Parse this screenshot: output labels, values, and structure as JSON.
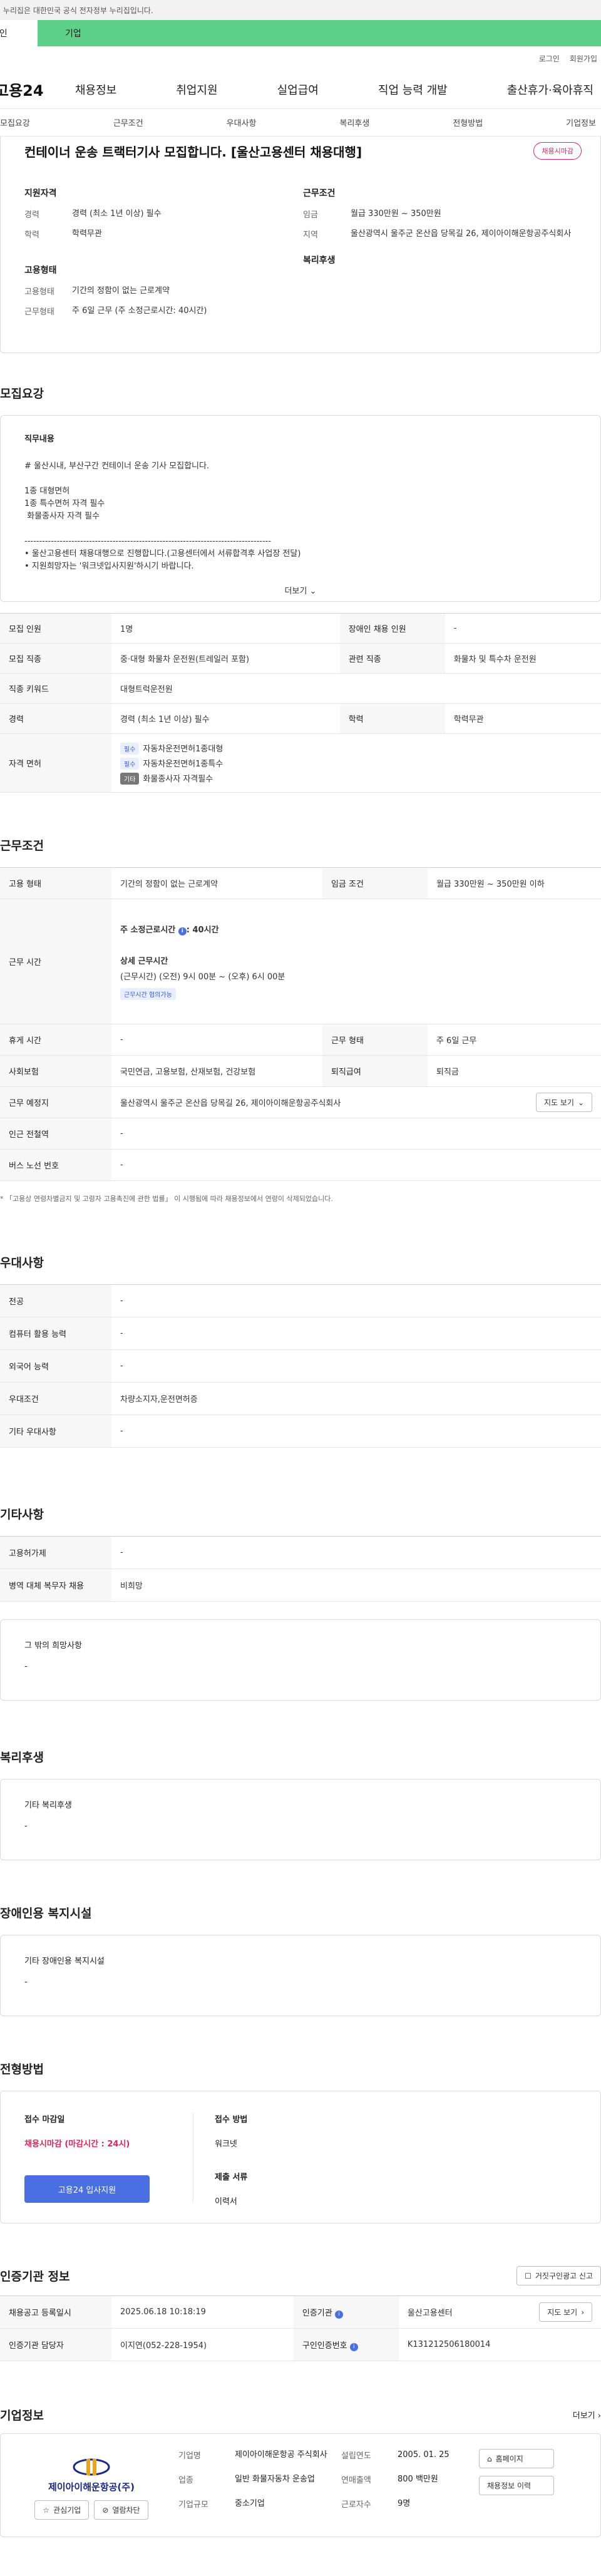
{
  "gov_notice": "이 누리집은 대한민국 공식 전자정부 누리집입니다.",
  "tabs": {
    "individual": "개인",
    "company": "기업"
  },
  "util": {
    "login": "로그인",
    "join": "회원가입"
  },
  "logo": "고용24",
  "gnb": [
    "채용정보",
    "취업지원",
    "실업급여",
    "직업 능력 개발",
    "출산휴가·육아휴직"
  ],
  "subnav": [
    "모집요강",
    "근무조건",
    "우대사항",
    "복리후생",
    "전형방법",
    "기업정보"
  ],
  "job": {
    "title": "컨테이너 운송 트랙터기사 모집합니다. [울산고용센터 채용대행]",
    "status_badge": "채용시마감",
    "qual_heading": "지원자격",
    "cond_heading": "근무조건",
    "type_heading": "고용형태",
    "welfare_heading": "복리후생",
    "career_label": "경력",
    "career_value": "경력 (최소 1년 이상) 필수",
    "edu_label": "학력",
    "edu_value": "학력무관",
    "wage_label": "임금",
    "wage_value": "월급 330만원 ~ 350만원",
    "region_label": "지역",
    "region_value": "울산광역시 울주군 온산읍 당목길 26, 제이아이해운항공주식회사",
    "emptype_label": "고용형태",
    "emptype_value": "기간의 정함이 없는 근로계약",
    "worktype_label": "근무형태",
    "worktype_value": "주 6일 근무 (주 소정근로시간: 40시간)"
  },
  "recruit": {
    "title": "모집요강",
    "duty_heading": "직무내용",
    "lines": [
      "# 울산시내, 부산구간 컨테이너 운송 기사 모집합니다.",
      "",
      "1종 대형면허",
      "1종 특수면허 자격 필수",
      " 화물종사자 자격 필수",
      "",
      "------------------------------------------------------------------------------------",
      "• 울산고용센터 채용대행으로 진행합니다.(고용센터에서 서류합격후 사업장 전달)",
      "• 지원희망자는 '워크넷입사지원'하시기 바랍니다."
    ],
    "more": "더보기",
    "table": {
      "headcount_k": "모집 인원",
      "headcount_v": "1명",
      "disabled_k": "장애인 채용 인원",
      "disabled_v": "-",
      "job_k": "모집 직종",
      "job_v": "중·대형 화물차 운전원(트레일러 포함)",
      "related_k": "관련 직종",
      "related_v": "화물차 및 특수차 운전원",
      "keyword_k": "직종 키워드",
      "keyword_v": "대형트럭운전원",
      "career_k": "경력",
      "career_v": "경력 (최소 1년 이상) 필수",
      "edu_k": "학력",
      "edu_v": "학력무관",
      "license_k": "자격 면허",
      "licenses": [
        {
          "tag": "필수",
          "name": "자동차운전면허1종대형"
        },
        {
          "tag": "필수",
          "name": "자동차운전면허1종특수"
        },
        {
          "tag": "기타",
          "name": "화물종사자 자격필수"
        }
      ]
    }
  },
  "conditions": {
    "title": "근무조건",
    "emptype_k": "고용 형태",
    "emptype_v": "기간의 정함이 없는 근로계약",
    "wage_k": "임금 조건",
    "wage_v": "월급 330만원 ~ 350만원 이하",
    "hours_k": "근무 시간",
    "hours_total_label": "주 소정근로시간",
    "hours_total_value": ": 40시간",
    "hours_detail_label": "상세 근무시간",
    "hours_detail_value": "(근무시간) (오전) 9시 00분 ~ (오후) 6시 00분",
    "hours_flex": "근무시간 협의가능",
    "rest_k": "휴게 시간",
    "rest_v": "-",
    "workform_k": "근무 형태",
    "workform_v": "주 6일 근무",
    "insurance_k": "사회보험",
    "insurance_v": "국민연금, 고용보험, 산재보험, 건강보험",
    "severance_k": "퇴직급여",
    "severance_v": "퇴직금",
    "location_k": "근무 예정지",
    "location_v": "울산광역시 울주군 온산읍 당목길 26, 제이아이해운항공주식회사",
    "map_btn": "지도 보기",
    "station_k": "인근 전철역",
    "station_v": "-",
    "bus_k": "버스 노선 번호",
    "bus_v": "-",
    "note": "* 「고용상 연령차별금지 및 고령자 고용촉진에 관한 법률」 이 시행됨에 따라 채용정보에서 연령이 삭제되었습니다."
  },
  "preference": {
    "title": "우대사항",
    "rows": [
      {
        "k": "전공",
        "v": "-"
      },
      {
        "k": "컴퓨터 활용 능력",
        "v": "-"
      },
      {
        "k": "외국어 능력",
        "v": "-"
      },
      {
        "k": "우대조건",
        "v": "차량소지자,운전면허증"
      },
      {
        "k": "기타 우대사항",
        "v": "-"
      }
    ]
  },
  "etc": {
    "title": "기타사항",
    "rows": [
      {
        "k": "고용허가제",
        "v": "-"
      },
      {
        "k": "병역 대체 복무자 채용",
        "v": "비희망"
      }
    ],
    "other_heading": "그 밖의 희망사항",
    "other_value": "-"
  },
  "welfare": {
    "title": "복리후생",
    "heading": "기타 복리후생",
    "value": "-"
  },
  "disability": {
    "title": "장애인용 복지시설",
    "heading": "기타 장애인용 복지시설",
    "value": "-"
  },
  "selection": {
    "title": "전형방법",
    "deadline_label": "접수 마감일",
    "deadline_value": "채용시마감 (마감시간 : 24시)",
    "apply_btn": "고용24 입사지원",
    "method_label": "접수 방법",
    "method_value": "워크넷",
    "docs_label": "제출 서류",
    "docs_value": "이력서"
  },
  "cert": {
    "title": "인증기관 정보",
    "report_btn": "거짓구인광고 신고",
    "reg_k": "채용공고 등록일시",
    "reg_v": "2025.06.18 10:18:19",
    "agency_k": "인증기관",
    "agency_v": "울산고용센터",
    "map_btn": "지도 보기",
    "manager_k": "인증기관 담당자",
    "manager_v": "이지연(052-228-1954)",
    "jobno_k": "구인인증번호",
    "jobno_v": "K131212506180014"
  },
  "company": {
    "title": "기업정보",
    "more": "더보기",
    "logo_text": "제이아이해운항공(주)",
    "fav_btn": "관심기업",
    "block_btn": "열람차단",
    "name_k": "기업명",
    "name_v": "제이아이해운항공 주식회사",
    "industry_k": "업종",
    "industry_v": "일반 화물자동차 운송업",
    "size_k": "기업규모",
    "size_v": "중소기업",
    "founded_k": "설립연도",
    "founded_v": "2005. 01. 25",
    "revenue_k": "연매출액",
    "revenue_v": "800 백만원",
    "staff_k": "근로자수",
    "staff_v": "9명",
    "homepage_btn": "홈페이지",
    "jobs_btn": "채용정보 이력"
  },
  "colors": {
    "brand_green": "#5dd08a",
    "accent_red": "#e0245e",
    "button_blue": "#4a6fe3"
  }
}
